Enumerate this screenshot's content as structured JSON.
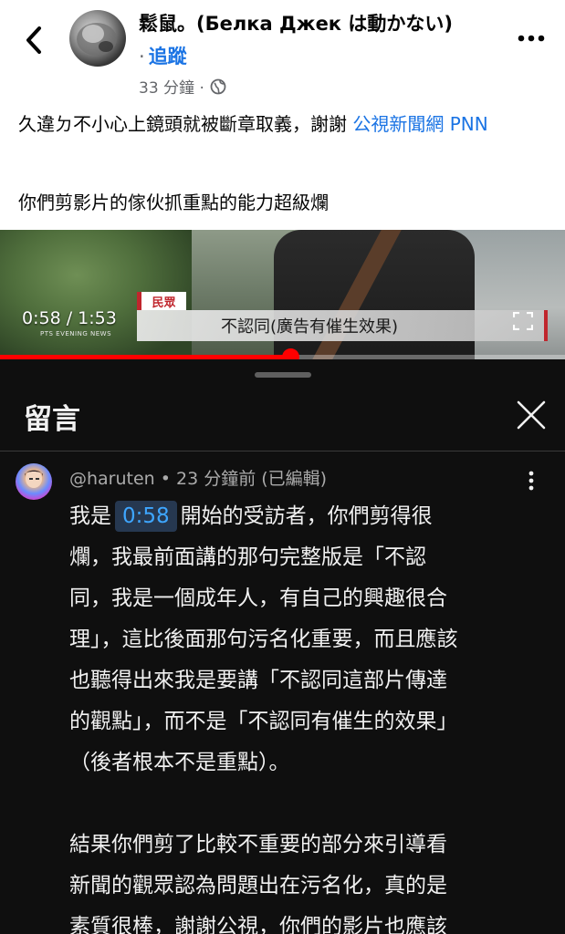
{
  "post": {
    "author": "鬆鼠。(Белка Джек は動かない)",
    "follow_dot": "·",
    "follow_label": "追蹤",
    "time": "33 分鐘 ·",
    "privacy_icon": "globe-icon",
    "text_line1": "久違ㄉ不小心上鏡頭就被斷章取義，謝謝 ",
    "text_link": "公視新聞網 PNN",
    "text_line2": "你們剪影片的傢伙抓重點的能力超級爛"
  },
  "video": {
    "current_time": "0:58 / 1:53",
    "caption_tag": "民眾",
    "caption": "不認同(廣告有催生效果)",
    "channel": "PTS EVENING NEWS",
    "progress": 0.513
  },
  "comments": {
    "title": "留言",
    "items": [
      {
        "author_meta": "@haruten • 23 分鐘前 (已編輯)",
        "line1_prefix": "我是",
        "timestamp": "0:58",
        "line1_suffix": "開始的受訪者，你們剪得很",
        "lines": [
          "爛，我最前面講的那句完整版是「不認",
          "同，我是一個成年人，有自己的興趣很合",
          "理」，這比後面那句污名化重要，而且應該",
          "也聽得出來我是要講「不認同這部片傳達",
          "的觀點」，而不是「不認同有催生的效果」",
          "（後者根本不是重點）。"
        ],
        "lines2": [
          "結果你們剪了比較不重要的部分來引導看",
          "新聞的觀眾認為問題出在污名化，真的是",
          "素質很棒，謝謝公視，你們的影片也應該"
        ]
      }
    ]
  },
  "colors": {
    "link_blue": "#1b74e4",
    "sheet_bg": "#0f0f0f",
    "progress_red": "#ff0000",
    "timestamp_chip": "#263850"
  }
}
